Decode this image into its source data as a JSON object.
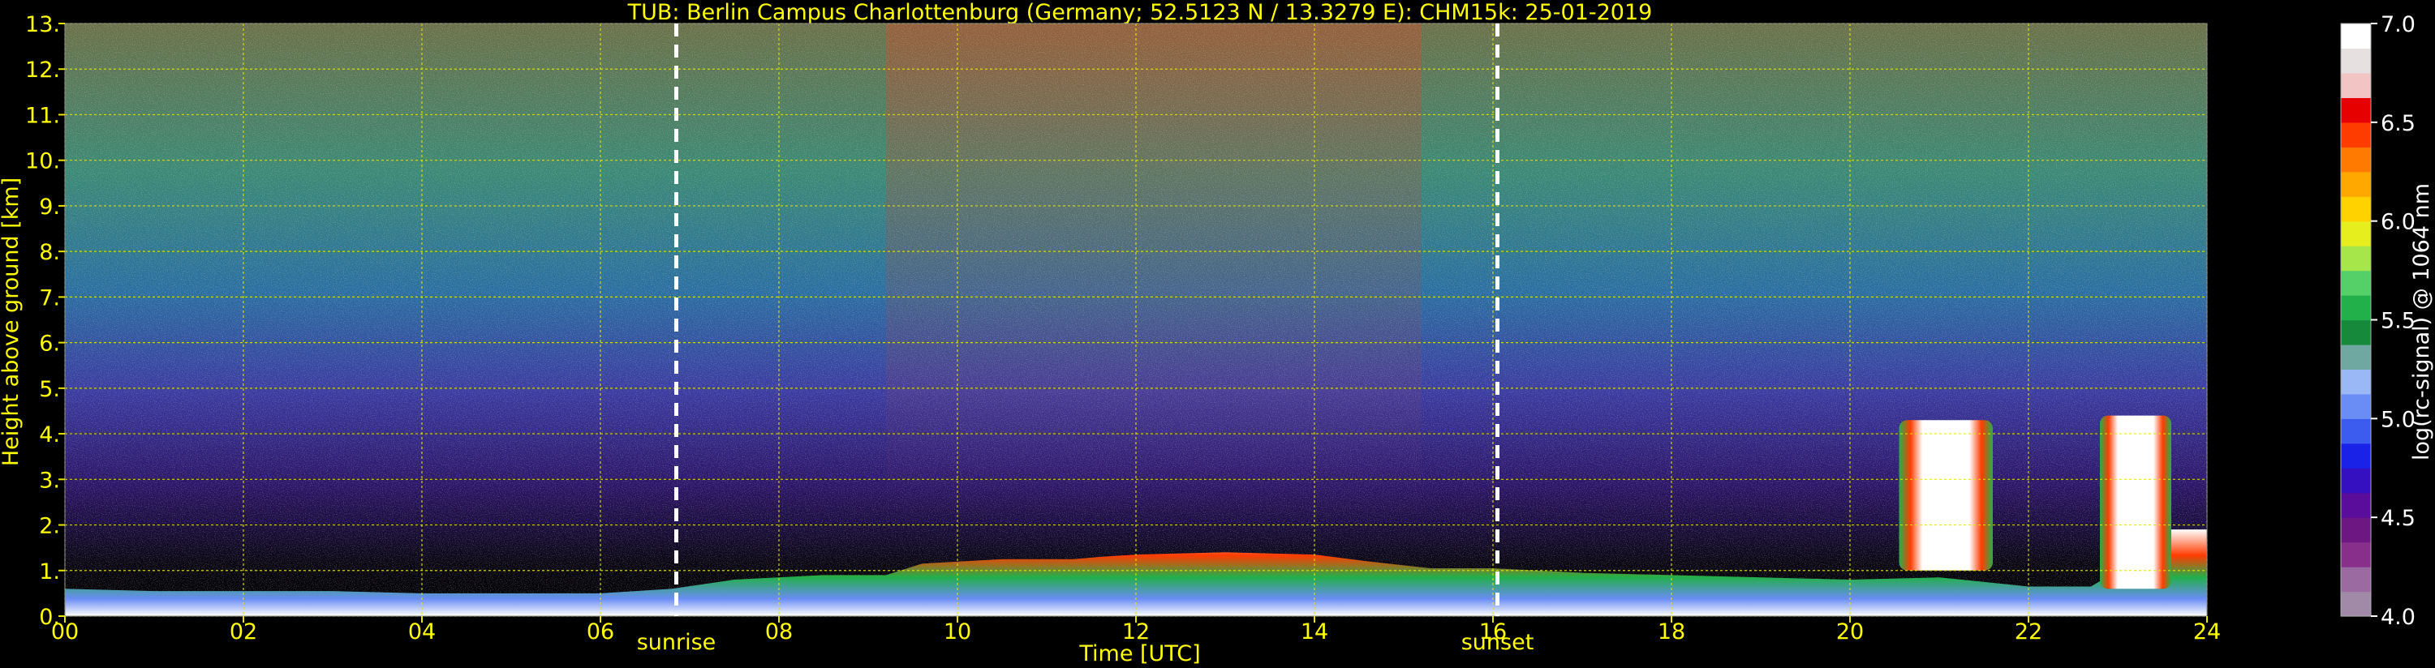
{
  "chart_data": {
    "type": "heatmap",
    "title": "TUB: Berlin Campus Charlottenburg (Germany; 52.5123 N / 13.3279 E):    CHM15k: 25-01-2019",
    "xlabel": "Time [UTC]",
    "ylabel": "Height above ground [km]",
    "xlim": [
      0,
      24
    ],
    "ylim": [
      0,
      13
    ],
    "x_ticks": [
      {
        "v": 0,
        "label": "00"
      },
      {
        "v": 2,
        "label": "02"
      },
      {
        "v": 4,
        "label": "04"
      },
      {
        "v": 6,
        "label": "06"
      },
      {
        "v": 8,
        "label": "08"
      },
      {
        "v": 10,
        "label": "10"
      },
      {
        "v": 12,
        "label": "12"
      },
      {
        "v": 14,
        "label": "14"
      },
      {
        "v": 16,
        "label": "16"
      },
      {
        "v": 18,
        "label": "18"
      },
      {
        "v": 20,
        "label": "20"
      },
      {
        "v": 22,
        "label": "22"
      },
      {
        "v": 24,
        "label": "24"
      }
    ],
    "y_ticks": [
      {
        "v": 0,
        "label": "0."
      },
      {
        "v": 1,
        "label": "1."
      },
      {
        "v": 2,
        "label": "2."
      },
      {
        "v": 3,
        "label": "3."
      },
      {
        "v": 4,
        "label": "4."
      },
      {
        "v": 5,
        "label": "5."
      },
      {
        "v": 6,
        "label": "6."
      },
      {
        "v": 7,
        "label": "7."
      },
      {
        "v": 8,
        "label": "8."
      },
      {
        "v": 9,
        "label": "9."
      },
      {
        "v": 10,
        "label": "10."
      },
      {
        "v": 11,
        "label": "11."
      },
      {
        "v": 12,
        "label": "12."
      },
      {
        "v": 13,
        "label": "13."
      }
    ],
    "grid": true,
    "markers": [
      {
        "x": 6.85,
        "label": "sunrise"
      },
      {
        "x": 16.05,
        "label": "sunset"
      }
    ],
    "colorbar": {
      "label": "log(rc-signal) @ 1064 nm",
      "min": 4.0,
      "max": 7.0,
      "ticks": [
        {
          "v": 4.0,
          "label": "4.0"
        },
        {
          "v": 4.5,
          "label": "4.5"
        },
        {
          "v": 5.0,
          "label": "5.0"
        },
        {
          "v": 5.5,
          "label": "5.5"
        },
        {
          "v": 6.0,
          "label": "6.0"
        },
        {
          "v": 6.5,
          "label": "6.5"
        },
        {
          "v": 7.0,
          "label": "7.0"
        }
      ],
      "colors": [
        "#a08aa8",
        "#9a6aa0",
        "#882f8c",
        "#6d1882",
        "#5a0c9a",
        "#3410c0",
        "#1a22e8",
        "#3c5cf0",
        "#6a8cf5",
        "#99b8f5",
        "#6ea8a0",
        "#168a3a",
        "#22b04a",
        "#55d068",
        "#a6e64a",
        "#e6ee1e",
        "#ffd200",
        "#ffa800",
        "#ff7a00",
        "#ff3c00",
        "#e60000",
        "#f2c4c4",
        "#e6e0e0",
        "#ffffff"
      ]
    },
    "bl_layer_top": [
      [
        0.0,
        0.6
      ],
      [
        1.0,
        0.55
      ],
      [
        2.0,
        0.55
      ],
      [
        3.0,
        0.55
      ],
      [
        4.0,
        0.5
      ],
      [
        5.0,
        0.5
      ],
      [
        6.0,
        0.5
      ],
      [
        6.8,
        0.6
      ],
      [
        7.5,
        0.8
      ],
      [
        8.5,
        0.9
      ],
      [
        9.2,
        0.9
      ],
      [
        9.6,
        1.15
      ],
      [
        10.5,
        1.25
      ],
      [
        11.3,
        1.25
      ],
      [
        11.6,
        1.3
      ],
      [
        12.0,
        1.35
      ],
      [
        13.0,
        1.4
      ],
      [
        14.0,
        1.35
      ],
      [
        14.6,
        1.2
      ],
      [
        15.3,
        1.05
      ],
      [
        16.0,
        1.05
      ],
      [
        17.0,
        0.95
      ],
      [
        18.0,
        0.9
      ],
      [
        19.0,
        0.85
      ],
      [
        20.0,
        0.8
      ],
      [
        21.0,
        0.85
      ],
      [
        22.0,
        0.65
      ],
      [
        22.7,
        0.65
      ],
      [
        23.0,
        1.0
      ],
      [
        23.4,
        1.9
      ],
      [
        24.0,
        1.9
      ]
    ],
    "cloud_features": [
      {
        "x_start": 20.55,
        "x_end": 21.6,
        "base_km": 1.0,
        "top_km": 4.3
      },
      {
        "x_start": 22.8,
        "x_end": 23.6,
        "base_km": 0.6,
        "top_km": 4.4
      }
    ]
  }
}
